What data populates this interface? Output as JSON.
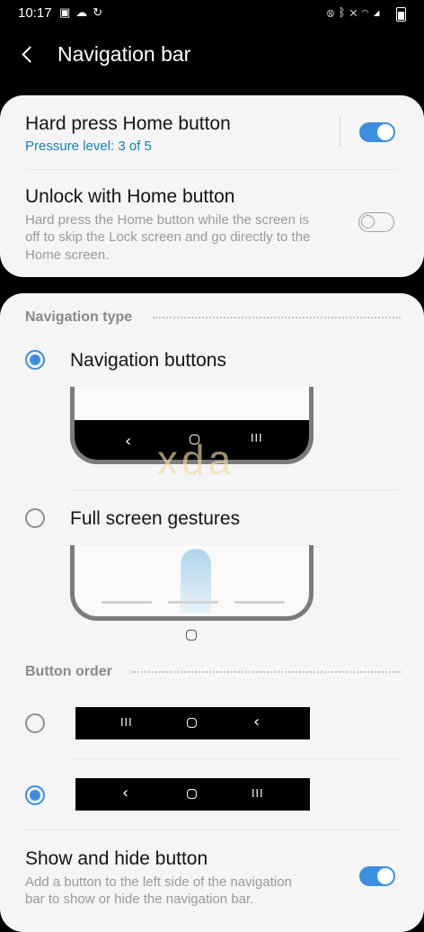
{
  "status_bar": {
    "time": "10:17",
    "left_icons": [
      "image-icon",
      "cloud-icon",
      "refresh-icon"
    ],
    "right_icons": [
      "nfc-icon",
      "bluetooth-icon",
      "mute-icon",
      "wifi-icon",
      "signal-icon",
      "battery-icon"
    ]
  },
  "header": {
    "title": "Navigation bar"
  },
  "settings": {
    "hard_press": {
      "title": "Hard press Home button",
      "subtitle": "Pressure level: 3 of 5",
      "enabled": true
    },
    "unlock_home": {
      "title": "Unlock with Home button",
      "description_lines": [
        "Hard press the Home button while the screen is",
        "off to skip the Lock screen and go directly to the",
        "Home screen."
      ],
      "enabled": false
    }
  },
  "navigation_type": {
    "label": "Navigation type",
    "options": [
      {
        "label": "Navigation buttons",
        "selected": true
      },
      {
        "label": "Full screen gestures",
        "selected": false
      }
    ]
  },
  "nav_glyphs": {
    "back": "‹",
    "recents": "III"
  },
  "watermark": "xda",
  "button_order": {
    "label": "Button order",
    "options": [
      {
        "order": [
          "recents",
          "home",
          "back"
        ],
        "selected": false
      },
      {
        "order": [
          "back",
          "home",
          "recents"
        ],
        "selected": true
      }
    ]
  },
  "show_hide": {
    "title": "Show and hide button",
    "description_lines": [
      "Add a button to the left side of the navigation",
      "bar to show or hide the navigation bar."
    ],
    "enabled": true
  },
  "colors": {
    "accent": "#3d8ede",
    "subtitle_accent": "#1b7fb2",
    "card_bg": "#f5f5f5"
  }
}
